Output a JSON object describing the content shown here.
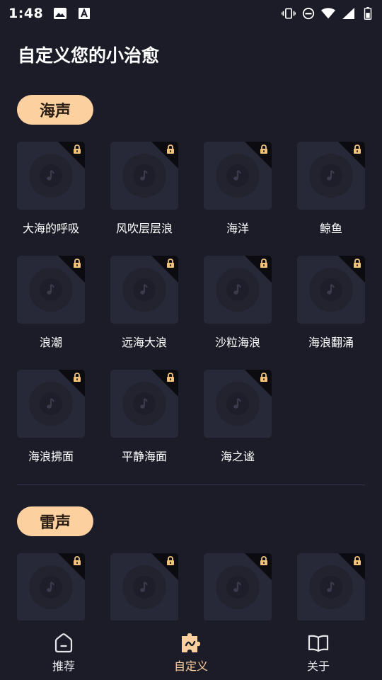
{
  "status": {
    "time": "1:48"
  },
  "page": {
    "title": "自定义您的小治愈"
  },
  "sections": [
    {
      "label": "海声",
      "items": [
        "大海的呼吸",
        "风吹层层浪",
        "海洋",
        "鲸鱼",
        "浪潮",
        "远海大浪",
        "沙粒海浪",
        "海浪翻涌",
        "海浪拂面",
        "平静海面",
        "海之谧"
      ]
    },
    {
      "label": "雷声",
      "items": [
        "",
        "",
        "",
        ""
      ]
    }
  ],
  "nav": {
    "items": [
      {
        "label": "推荐",
        "icon": "home-icon"
      },
      {
        "label": "自定义",
        "icon": "puzzle-icon",
        "active": true
      },
      {
        "label": "关于",
        "icon": "book-icon"
      }
    ]
  },
  "colors": {
    "background": "#1b1c27",
    "card": "#272838",
    "accent": "#fdd0a0",
    "lock": "#f2c37a"
  }
}
